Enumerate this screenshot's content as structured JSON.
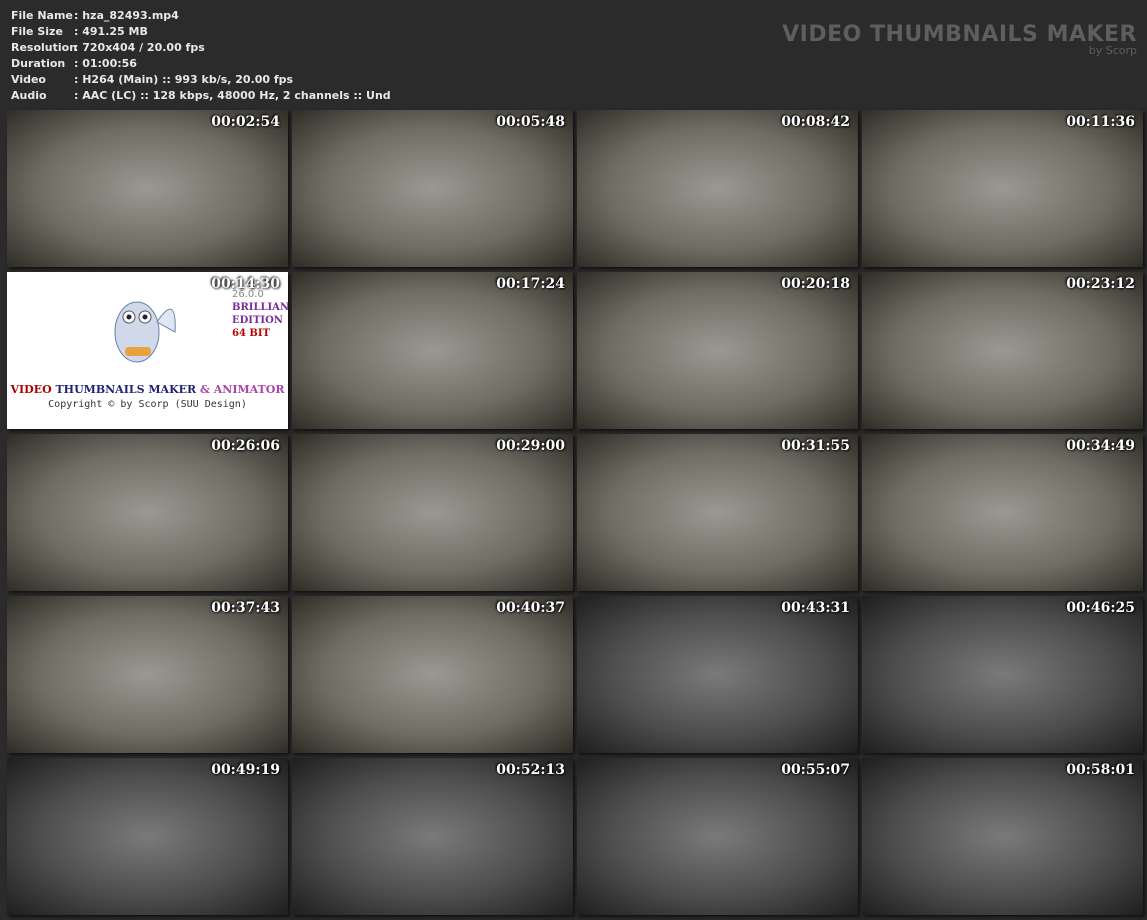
{
  "info": [
    {
      "label": "File Name",
      "value": ": hza_82493.mp4"
    },
    {
      "label": "File Size",
      "value": ": 491.25 MB"
    },
    {
      "label": "Resolution",
      "value": ": 720x404 / 20.00 fps"
    },
    {
      "label": "Duration",
      "value": ": 01:00:56"
    },
    {
      "label": "Video",
      "value": ": H264 (Main) :: 993 kb/s, 20.00 fps"
    },
    {
      "label": "Audio",
      "value": ": AAC (LC) :: 128 kbps, 48000 Hz, 2 channels :: Und"
    }
  ],
  "brand": {
    "title": "VIDEO THUMBNAILS MAKER",
    "by": "by Scorp"
  },
  "logo": {
    "version": "26.0.0",
    "edition1": "BRILLIANT",
    "edition2": "EDITION",
    "bits": "64 BIT",
    "name_a": "VIDEO ",
    "name_b": "THUMBNAILS MAKER",
    "name_c": " & ANIMATOR",
    "copyright": "Copyright © by Scorp (SUU Design)"
  },
  "thumbs": [
    {
      "time": "00:02:54",
      "dark": false
    },
    {
      "time": "00:05:48",
      "dark": false
    },
    {
      "time": "00:08:42",
      "dark": false
    },
    {
      "time": "00:11:36",
      "dark": false
    },
    {
      "time": "00:14:30",
      "logo": true
    },
    {
      "time": "00:17:24",
      "dark": false
    },
    {
      "time": "00:20:18",
      "dark": false
    },
    {
      "time": "00:23:12",
      "dark": false
    },
    {
      "time": "00:26:06",
      "dark": false
    },
    {
      "time": "00:29:00",
      "dark": false
    },
    {
      "time": "00:31:55",
      "dark": false
    },
    {
      "time": "00:34:49",
      "dark": false
    },
    {
      "time": "00:37:43",
      "dark": false
    },
    {
      "time": "00:40:37",
      "dark": false
    },
    {
      "time": "00:43:31",
      "dark": true
    },
    {
      "time": "00:46:25",
      "dark": true
    },
    {
      "time": "00:49:19",
      "dark": true
    },
    {
      "time": "00:52:13",
      "dark": true
    },
    {
      "time": "00:55:07",
      "dark": true
    },
    {
      "time": "00:58:01",
      "dark": true
    }
  ]
}
